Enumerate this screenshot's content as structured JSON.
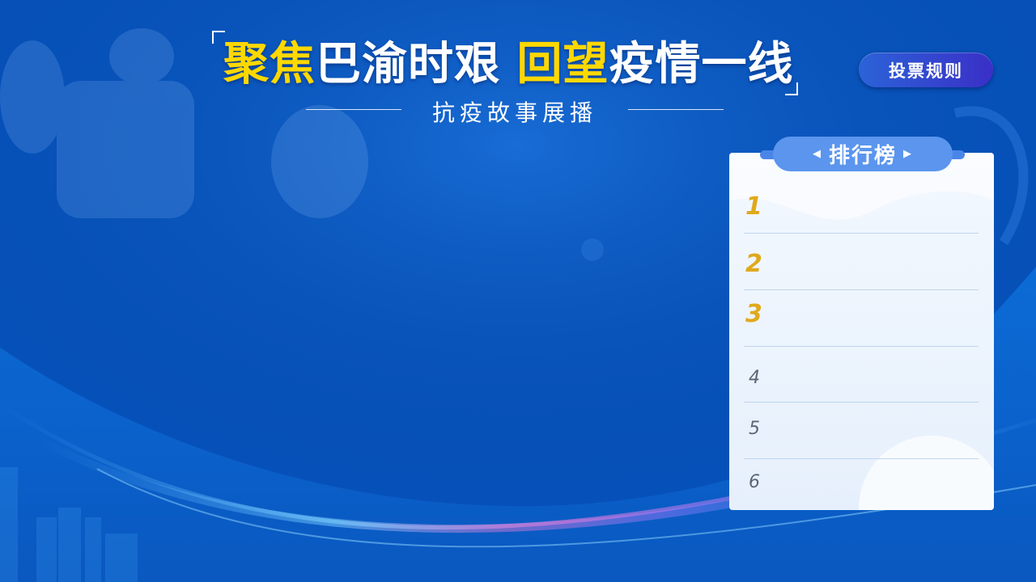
{
  "header": {
    "title_part1": "聚焦",
    "title_part2": "巴渝时艰",
    "title_part3": "回望",
    "title_part4": "疫情一线",
    "subtitle": "抗疫故事展播"
  },
  "rules_button": {
    "label": "投票规则"
  },
  "ranking": {
    "tab_label": "排行榜",
    "tab_arrow_left": "◀",
    "tab_arrow_right": "▶",
    "rows": [
      {
        "rank": "1"
      },
      {
        "rank": "2"
      },
      {
        "rank": "3"
      },
      {
        "rank": "4"
      },
      {
        "rank": "5"
      },
      {
        "rank": "6"
      }
    ]
  },
  "colors": {
    "accent_yellow": "#ffd800",
    "medal_gold": "#e0a91c",
    "background_blue": "#0a5ec8",
    "button_gradient_start": "#2b63d8",
    "button_gradient_end": "#3a2fc7"
  }
}
